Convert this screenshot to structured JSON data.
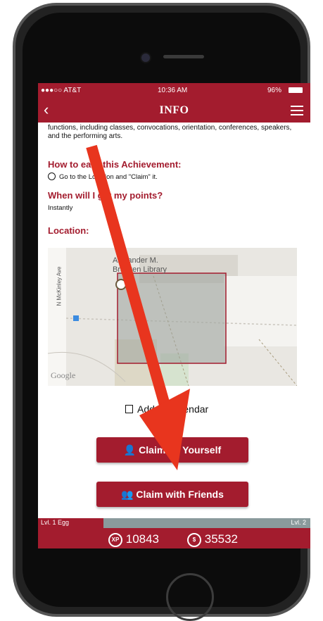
{
  "status_bar": {
    "carrier": "●●●○○ AT&T",
    "time": "10:36 AM",
    "battery": "96%"
  },
  "nav": {
    "title": "INFO",
    "back_icon": "chevron-left-icon",
    "menu_icon": "hamburger-icon"
  },
  "description": "functions, including classes, convocations, orientation, conferences, speakers, and the performing arts.",
  "how_to_earn": {
    "heading": "How to earn this Achievement:",
    "step": "Go to the Location and \"Claim\" it."
  },
  "when_points": {
    "heading": "When will I get my points?",
    "answer": "Instantly"
  },
  "location": {
    "heading": "Location:"
  },
  "map": {
    "place_label": "Alexander M. Bracken Library",
    "street_label": "N McKinley Ave",
    "attribution": "Google"
  },
  "calendar_link": "Add to Calendar",
  "buttons": {
    "claim_yourself": "Claim by Yourself",
    "claim_friends": "Claim with Friends"
  },
  "level": {
    "current": "Lvl. 1 Egg",
    "next": "Lvl. 2",
    "progress": 0.24
  },
  "points": {
    "xp": "10843",
    "coins": "35532",
    "xp_icon": "XP",
    "coin_icon": "coin-icon"
  },
  "colors": {
    "brand": "#a31c2e",
    "arrow": "#e8351e"
  }
}
